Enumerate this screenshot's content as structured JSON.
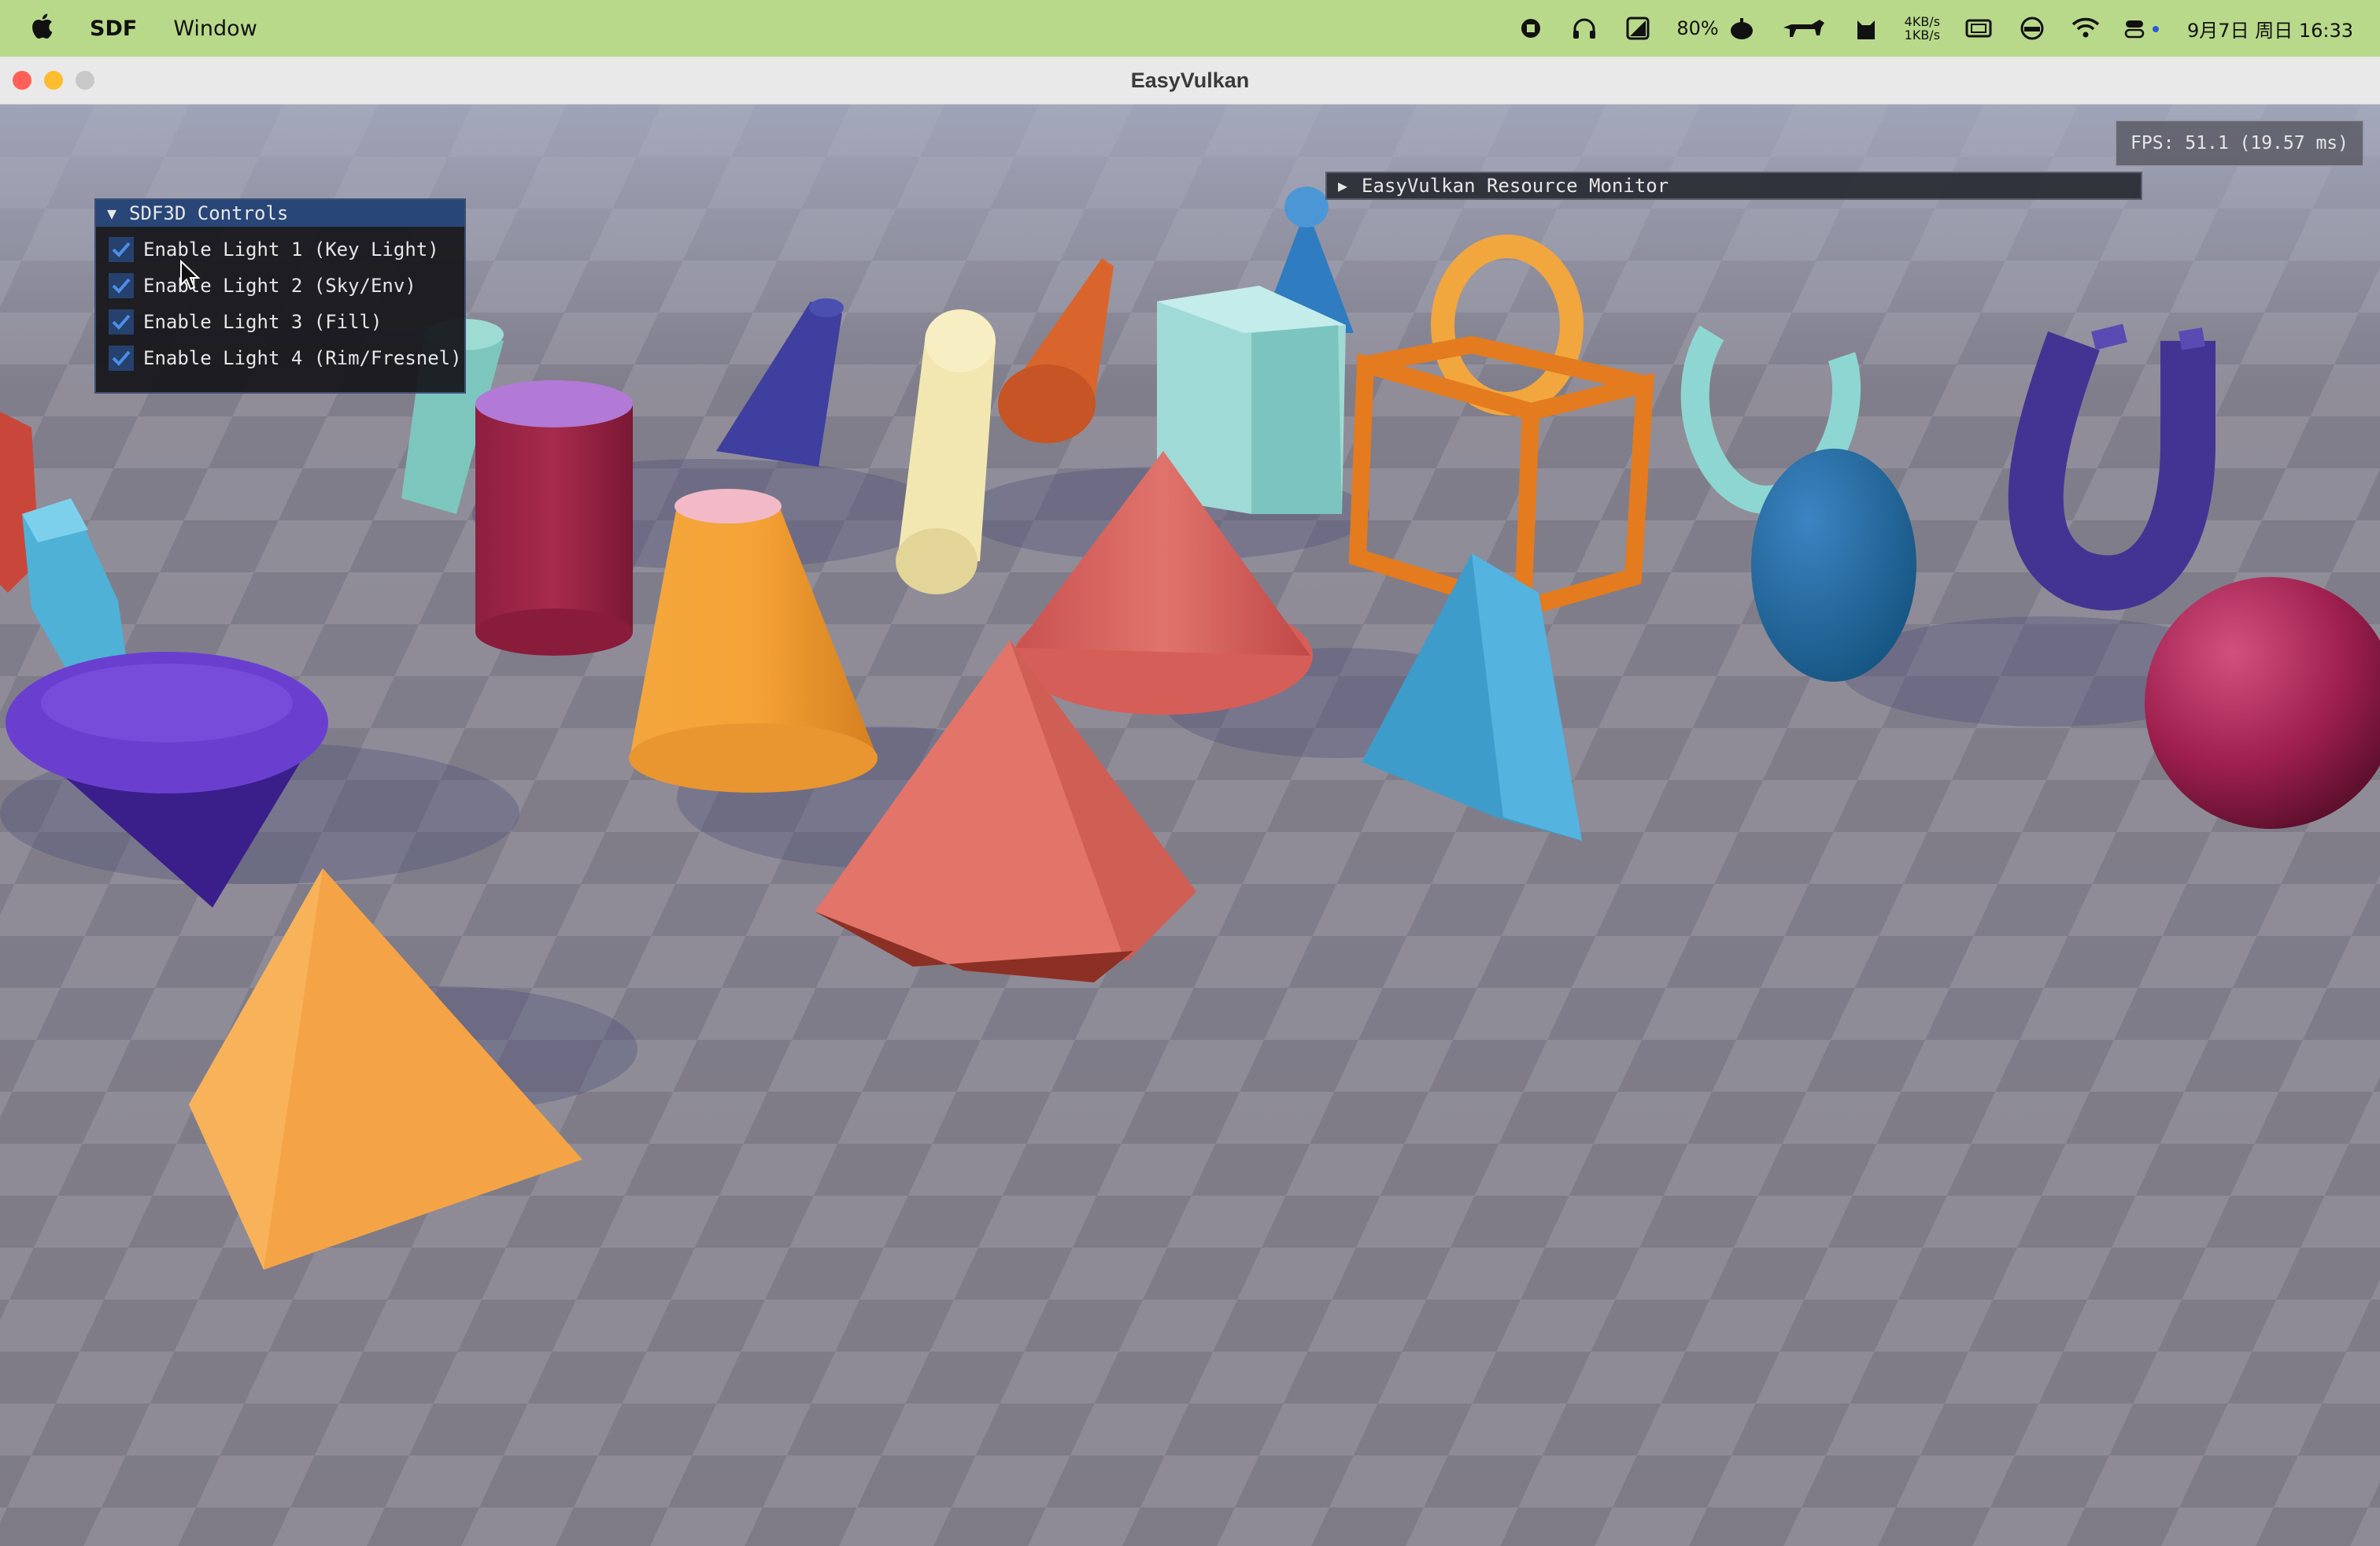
{
  "menubar": {
    "app_name": "SDF",
    "menu_items": [
      "Window"
    ],
    "battery_percent": "80%",
    "net_up": "4KB/s",
    "net_down": "1KB/s",
    "datetime": "9月7日 周日  16:33",
    "icons": [
      "apple-icon",
      "record-icon",
      "headphones-icon",
      "activity-icon",
      "battery-icon",
      "dog-icon",
      "cat-icon",
      "screen-mirror-icon",
      "vpn-icon",
      "wifi-icon",
      "control-center-icon"
    ]
  },
  "window": {
    "title": "EasyVulkan"
  },
  "overlay": {
    "fps_text": "FPS: 51.1 (19.57 ms)",
    "monitor_title": "EasyVulkan Resource Monitor",
    "controls_title": "SDF3D Controls",
    "lights": [
      {
        "label": "Enable Light 1 (Key Light)",
        "checked": true
      },
      {
        "label": "Enable Light 2 (Sky/Env)",
        "checked": true
      },
      {
        "label": "Enable Light 3 (Fill)",
        "checked": true
      },
      {
        "label": "Enable Light 4 (Rim/Fresnel)",
        "checked": true
      }
    ]
  },
  "colors": {
    "menubar_bg": "#b9d98a",
    "imgui_header": "#284677",
    "check": "#4d8ee6"
  }
}
